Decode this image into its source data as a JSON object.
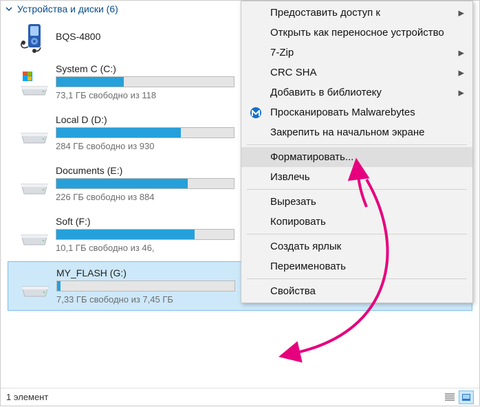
{
  "section": {
    "title": "Устройства и диски (6)"
  },
  "devices": [
    {
      "name": "BQS-4800",
      "type": "media"
    },
    {
      "name": "System C (C:)",
      "fill_pct": 38,
      "sub": "73,1 ГБ свободно из 118",
      "type": "drive",
      "os": true
    },
    {
      "name": "Local D (D:)",
      "fill_pct": 70,
      "sub": "284 ГБ свободно из 930",
      "type": "drive"
    },
    {
      "name": "Documents (E:)",
      "fill_pct": 74,
      "sub": "226 ГБ свободно из 884",
      "type": "drive"
    },
    {
      "name": "Soft (F:)",
      "fill_pct": 78,
      "sub": "10,1 ГБ свободно из 46,",
      "type": "drive"
    },
    {
      "name": "MY_FLASH (G:)",
      "fill_pct": 2,
      "sub": "7,33 ГБ свободно из 7,45 ГБ",
      "type": "drive",
      "selected": true
    }
  ],
  "menu": {
    "grant_access": "Предоставить доступ к",
    "open_portable": "Открыть как переносное устройство",
    "seven_zip": "7-Zip",
    "crc_sha": "CRC SHA",
    "add_library": "Добавить в библиотеку",
    "scan_mwb": "Просканировать Malwarebytes",
    "pin_start": "Закрепить на начальном экране",
    "format": "Форматировать...",
    "eject": "Извлечь",
    "cut": "Вырезать",
    "copy": "Копировать",
    "shortcut": "Создать ярлык",
    "rename": "Переименовать",
    "properties": "Свойства"
  },
  "status": {
    "text": "1 элемент"
  },
  "colors": {
    "accent": "#26a0da",
    "selection": "#cde8f9",
    "annotation": "#e6007e"
  }
}
